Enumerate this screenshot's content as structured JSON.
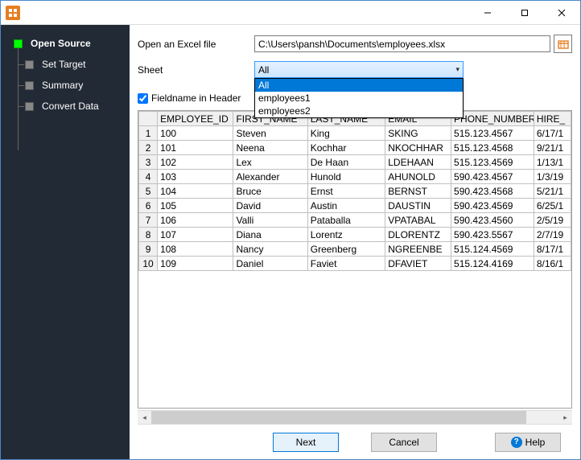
{
  "sidebar": {
    "items": [
      {
        "label": "Open Source"
      },
      {
        "label": "Set Target"
      },
      {
        "label": "Summary"
      },
      {
        "label": "Convert Data"
      }
    ]
  },
  "form": {
    "file_label": "Open an Excel file",
    "file_value": "C:\\Users\\pansh\\Documents\\employees.xlsx",
    "sheet_label": "Sheet",
    "sheet_selected": "All",
    "sheet_options": [
      "All",
      "employees1",
      "employees2"
    ],
    "fieldname_label": "Fieldname in Header"
  },
  "table": {
    "columns": [
      "EMPLOYEE_ID",
      "FIRST_NAME",
      "LAST_NAME",
      "EMAIL",
      "PHONE_NUMBER",
      "HIRE_"
    ],
    "rows": [
      [
        "100",
        "Steven",
        "King",
        "SKING",
        "515.123.4567",
        "6/17/1"
      ],
      [
        "101",
        "Neena",
        "Kochhar",
        "NKOCHHAR",
        "515.123.4568",
        "9/21/1"
      ],
      [
        "102",
        "Lex",
        "De Haan",
        "LDEHAAN",
        "515.123.4569",
        "1/13/1"
      ],
      [
        "103",
        "Alexander",
        "Hunold",
        "AHUNOLD",
        "590.423.4567",
        "1/3/19"
      ],
      [
        "104",
        "Bruce",
        "Ernst",
        "BERNST",
        "590.423.4568",
        "5/21/1"
      ],
      [
        "105",
        "David",
        "Austin",
        "DAUSTIN",
        "590.423.4569",
        "6/25/1"
      ],
      [
        "106",
        "Valli",
        "Pataballa",
        "VPATABAL",
        "590.423.4560",
        "2/5/19"
      ],
      [
        "107",
        "Diana",
        "Lorentz",
        "DLORENTZ",
        "590.423.5567",
        "2/7/19"
      ],
      [
        "108",
        "Nancy",
        "Greenberg",
        "NGREENBE",
        "515.124.4569",
        "8/17/1"
      ],
      [
        "109",
        "Daniel",
        "Faviet",
        "DFAVIET",
        "515.124.4169",
        "8/16/1"
      ]
    ]
  },
  "footer": {
    "next": "Next",
    "cancel": "Cancel",
    "help": "Help"
  }
}
